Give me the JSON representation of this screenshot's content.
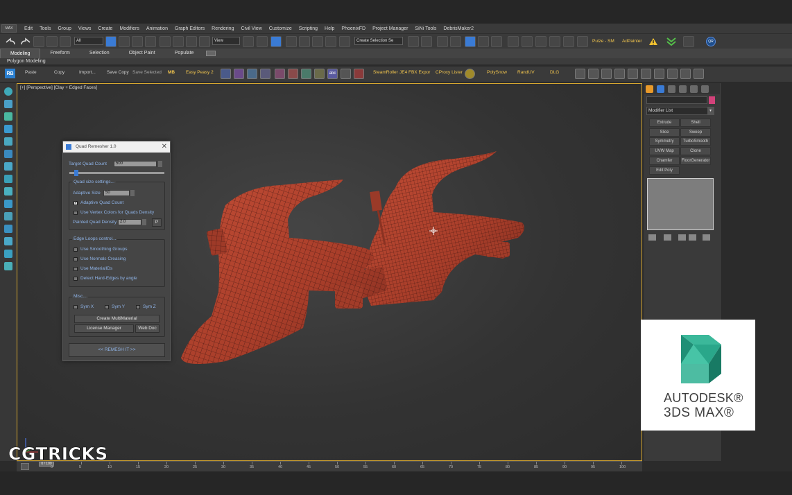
{
  "menu": {
    "logo": "MAX",
    "items": [
      "Edit",
      "Tools",
      "Group",
      "Views",
      "Create",
      "Modifiers",
      "Animation",
      "Graph Editors",
      "Rendering",
      "Civil View",
      "Customize",
      "Scripting",
      "Help",
      "PhoenixFD",
      "Project Manager",
      "SiNi Tools",
      "DebrisMaker2"
    ]
  },
  "toolbar": {
    "filter_select": "All",
    "view_select": "View",
    "selection_set": "Create Selection Se",
    "pulze": "Pulze - SM",
    "adpainter": "AdPainter"
  },
  "ribbon": {
    "tabs": [
      "Modeling",
      "Freeform",
      "Selection",
      "Object Paint",
      "Populate"
    ],
    "active_tab": "Modeling",
    "sub_label": "Polygon Modeling"
  },
  "toolbar2": {
    "rb_badge": "RB",
    "paste": "Paste",
    "copy": "Copy",
    "import": "Import...",
    "save_copy": "Save Copy",
    "save_selected": "Save Selected",
    "mb": "MB",
    "easy_peasy": "Easy Peasy 2",
    "steamroller": "SteamRoller",
    "je4": "JE4 FBX Expor",
    "cproxy": "CProxy Lister",
    "polysnow": "PolySnow",
    "randuv": "RandUV",
    "dlg": "DLG"
  },
  "viewport": {
    "label": "[+] [Perspective] [Clay + Edged Faces]"
  },
  "quad_remesher": {
    "title": "Quad Remesher 1.0",
    "target_label": "Target Quad Count",
    "target_value": "500",
    "quad_size_header": "Quad size settings...",
    "adaptive_size_label": "Adaptive Size",
    "adaptive_size_value": "50",
    "adaptive_quad_count": "Adaptive Quad Count",
    "use_vertex_colors": "Use Vertex Colors for Quads Density",
    "painted_density_label": "Painted Quad Density",
    "painted_density_value": "2.0",
    "p_button": "P",
    "edge_loops_header": "Edge Loops control...",
    "use_smoothing": "Use Smoothing Groups",
    "use_normals": "Use Normals Creasing",
    "use_material_ids": "Use MaterialIDs",
    "detect_hard_edges": "Detect Hard-Edges by angle",
    "misc_header": "Misc...",
    "sym_x": "Sym X",
    "sym_y": "Sym Y",
    "sym_z": "Sym Z",
    "create_multimaterial": "Create MultiMaterial",
    "license_manager": "License Manager",
    "web_doc": "Web Doc",
    "remesh": "<<   REMESH IT   >>",
    "adaptive_quad_count_checked": true
  },
  "command_panel": {
    "modifier_list": "Modifier List",
    "buttons": [
      "Extrude",
      "Shell",
      "Slice",
      "Sweep",
      "Symmetry",
      "TurboSmooth",
      "UVW Map",
      "Clone",
      "Chamfer",
      "FloorGenerator",
      "Edit Poly"
    ],
    "swatch_color": "#d2427a"
  },
  "timeline": {
    "slider": "0 / 100",
    "ticks": [
      "0",
      "5",
      "10",
      "15",
      "20",
      "25",
      "30",
      "35",
      "40",
      "45",
      "50",
      "55",
      "60",
      "65",
      "70",
      "75",
      "80",
      "85",
      "90",
      "95",
      "100"
    ]
  },
  "watermark": {
    "cgtricks": "CGTRICKS",
    "autodesk": "AUTODESK®",
    "product": "3DS MAX®"
  },
  "colors": {
    "model_red": "#b9442e",
    "viewport_border": "#d8a830",
    "logo_teal": "#2bb59a"
  }
}
